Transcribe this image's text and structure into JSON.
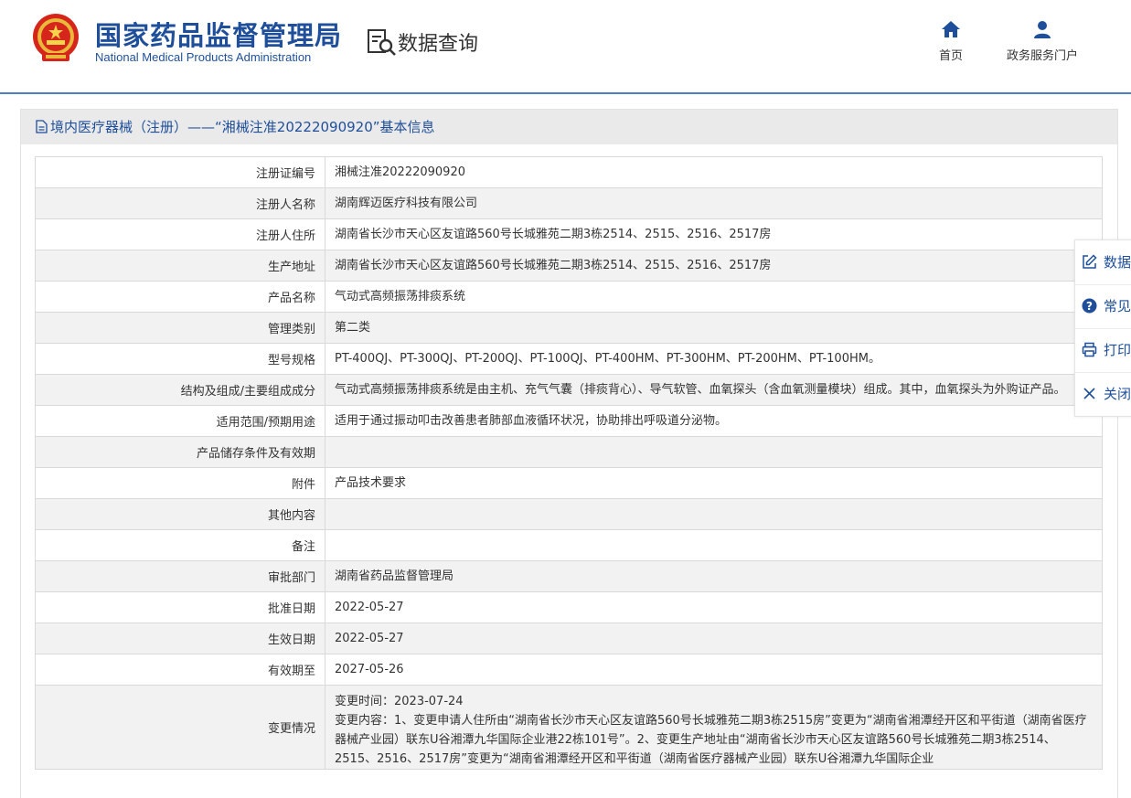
{
  "header": {
    "agency_cn": "国家药品监督管理局",
    "agency_en": "National Medical Products Administration",
    "section_title": "数据查询",
    "nav": [
      {
        "label": "首页",
        "icon": "home-icon"
      },
      {
        "label": "政务服务门户",
        "icon": "user-icon"
      }
    ]
  },
  "panel": {
    "title": "境内医疗器械（注册）——“湘械注准20222090920”基本信息"
  },
  "rows": [
    {
      "label": "注册证编号",
      "value": "湘械注准20222090920"
    },
    {
      "label": "注册人名称",
      "value": "湖南辉迈医疗科技有限公司"
    },
    {
      "label": "注册人住所",
      "value": "湖南省长沙市天心区友谊路560号长城雅苑二期3栋2514、2515、2516、2517房"
    },
    {
      "label": "生产地址",
      "value": "湖南省长沙市天心区友谊路560号长城雅苑二期3栋2514、2515、2516、2517房"
    },
    {
      "label": "产品名称",
      "value": "气动式高频振荡排痰系统"
    },
    {
      "label": "管理类别",
      "value": "第二类"
    },
    {
      "label": "型号规格",
      "value": "PT-400QJ、PT-300QJ、PT-200QJ、PT-100QJ、PT-400HM、PT-300HM、PT-200HM、PT-100HM。"
    },
    {
      "label": "结构及组成/主要组成成分",
      "value": "气动式高频振荡排痰系统是由主机、充气气囊（排痰背心）、导气软管、血氧探头（含血氧测量模块）组成。其中，血氧探头为外购证产品。"
    },
    {
      "label": "适用范围/预期用途",
      "value": "适用于通过振动叩击改善患者肺部血液循环状况，协助排出呼吸道分泌物。"
    },
    {
      "label": "产品储存条件及有效期",
      "value": ""
    },
    {
      "label": "附件",
      "value": "产品技术要求"
    },
    {
      "label": "其他内容",
      "value": ""
    },
    {
      "label": "备注",
      "value": ""
    },
    {
      "label": "审批部门",
      "value": "湖南省药品监督管理局"
    },
    {
      "label": "批准日期",
      "value": "2022-05-27"
    },
    {
      "label": "生效日期",
      "value": "2022-05-27"
    },
    {
      "label": "有效期至",
      "value": "2027-05-26"
    },
    {
      "label": "变更情况",
      "value_line1": "变更时间：2023-07-24",
      "value_line2": "变更内容：1、变更申请人住所由“湖南省长沙市天心区友谊路560号长城雅苑二期3栋2515房”变更为“湖南省湘潭经开区和平街道（湖南省医疗器械产业园）联东U谷湘潭九华国际企业港22栋101号”。2、变更生产地址由“湖南省长沙市天心区友谊路560号长城雅苑二期3栋2514、2515、2516、2517房”变更为“湖南省湘潭经开区和平街道（湖南省医疗器械产业园）联东U谷湘潭九华国际企业"
    }
  ],
  "float_bar": [
    {
      "label": "数据",
      "icon": "edit-icon"
    },
    {
      "label": "常见",
      "icon": "question-icon"
    },
    {
      "label": "打印",
      "icon": "print-icon"
    },
    {
      "label": "关闭",
      "icon": "close-icon"
    }
  ],
  "colors": {
    "brand": "#1f4f9a",
    "accent": "#4c7fbd",
    "row_alt": "#f2f2f2"
  }
}
